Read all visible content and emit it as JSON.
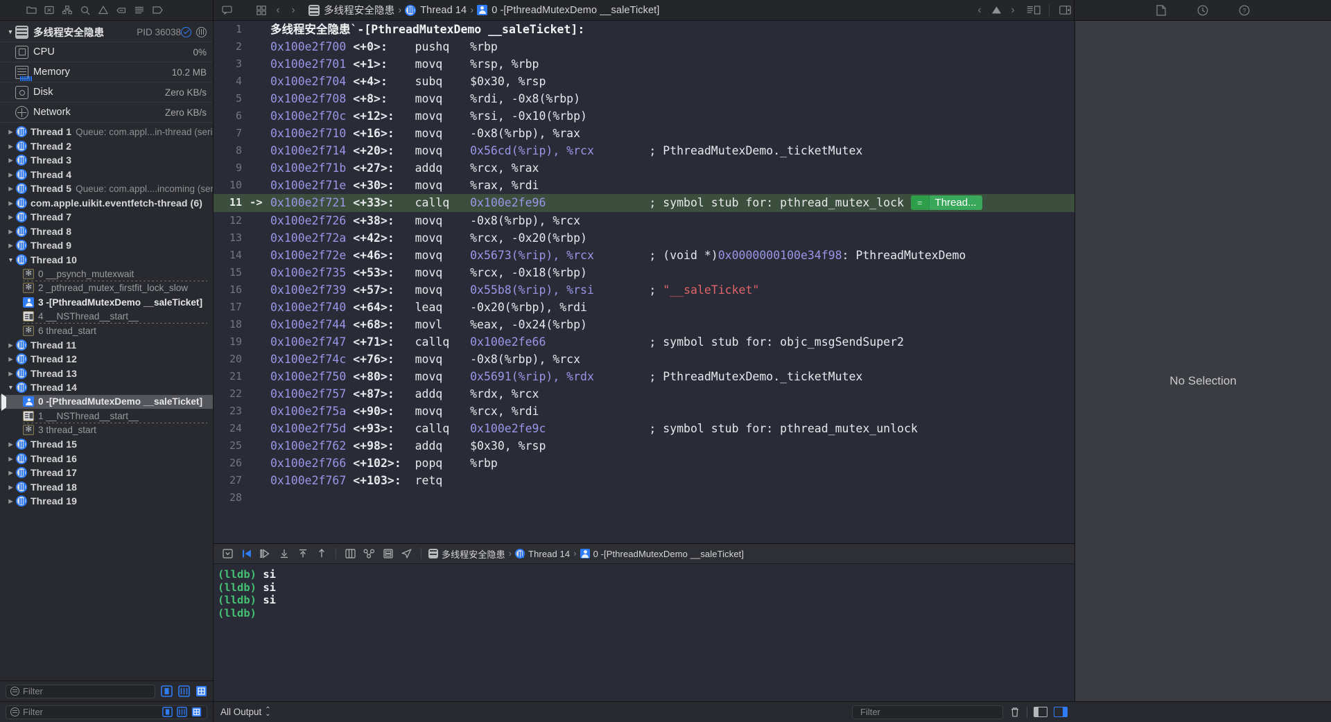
{
  "toolbar": {
    "left_icons": [
      "comment-icon"
    ],
    "mid_icons": [
      "navigator-toggle-icon",
      "back-chevron-icon",
      "forward-chevron-icon"
    ],
    "right_icons": [
      "document-icon",
      "history-clock-icon",
      "help-question-icon"
    ],
    "jump_icons": [
      "back-chevron-icon",
      "warning-triangle-icon",
      "forward-chevron-icon",
      "assistant-editor-icon",
      "inspector-toggle-icon"
    ],
    "breadcrumb": [
      {
        "icon": "project-icon",
        "label": "多线程安全隐患"
      },
      {
        "icon": "thread-icon",
        "label": "Thread 14"
      },
      {
        "icon": "stack-frame-icon",
        "label": "0 -[PthreadMutexDemo __saleTicket]"
      }
    ]
  },
  "navigator": {
    "icon_row": [
      "folder-icon",
      "source-control-icon",
      "hierarchy-icon",
      "search-icon",
      "warning-icon",
      "breakpoint-icon",
      "report-icon",
      "tag-icon"
    ],
    "process": {
      "name": "多线程安全隐患",
      "pid": "PID 36038",
      "status_icons": [
        "circle-check-icon",
        "thread-gauge-icon"
      ]
    },
    "gauges": [
      {
        "icon": "cpu-icon",
        "name": "CPU",
        "value": "0%"
      },
      {
        "icon": "memory-icon",
        "name": "Memory",
        "value": "10.2 MB"
      },
      {
        "icon": "disk-icon",
        "name": "Disk",
        "value": "Zero KB/s"
      },
      {
        "icon": "network-icon",
        "name": "Network",
        "value": "Zero KB/s"
      }
    ],
    "threads": [
      {
        "kind": "thread",
        "state": "collapsed",
        "label": "Thread 1",
        "queue": "Queue: com.appl...in-thread (serial)"
      },
      {
        "kind": "thread",
        "state": "collapsed",
        "label": "Thread 2",
        "queue": ""
      },
      {
        "kind": "thread",
        "state": "collapsed",
        "label": "Thread 3",
        "queue": ""
      },
      {
        "kind": "thread",
        "state": "collapsed",
        "label": "Thread 4",
        "queue": ""
      },
      {
        "kind": "thread",
        "state": "collapsed",
        "label": "Thread 5",
        "queue": "Queue: com.appl....incoming (serial)"
      },
      {
        "kind": "thread",
        "state": "collapsed",
        "label": "com.apple.uikit.eventfetch-thread (6)",
        "queue": ""
      },
      {
        "kind": "thread",
        "state": "collapsed",
        "label": "Thread 7",
        "queue": ""
      },
      {
        "kind": "thread",
        "state": "collapsed",
        "label": "Thread 8",
        "queue": ""
      },
      {
        "kind": "thread",
        "state": "collapsed",
        "label": "Thread 9",
        "queue": ""
      },
      {
        "kind": "thread",
        "state": "expanded",
        "label": "Thread 10",
        "queue": ""
      },
      {
        "kind": "frame",
        "icon": "system-frame-icon",
        "label": "0 __psynch_mutexwait",
        "user": false,
        "selected": false,
        "divider": true
      },
      {
        "kind": "frame",
        "icon": "system-frame-icon",
        "label": "2 _pthread_mutex_firstfit_lock_slow",
        "user": false,
        "selected": false,
        "divider": false
      },
      {
        "kind": "frame",
        "icon": "user-frame-icon",
        "label": "3 -[PthreadMutexDemo __saleTicket]",
        "user": true,
        "selected": false,
        "divider": false
      },
      {
        "kind": "frame",
        "icon": "nsthread-frame-icon",
        "label": "4 __NSThread__start__",
        "user": false,
        "selected": false,
        "divider": true
      },
      {
        "kind": "frame",
        "icon": "system-frame-icon",
        "label": "6 thread_start",
        "user": false,
        "selected": false,
        "divider": false
      },
      {
        "kind": "thread",
        "state": "collapsed",
        "label": "Thread 11",
        "queue": ""
      },
      {
        "kind": "thread",
        "state": "collapsed",
        "label": "Thread 12",
        "queue": ""
      },
      {
        "kind": "thread",
        "state": "collapsed",
        "label": "Thread 13",
        "queue": ""
      },
      {
        "kind": "thread",
        "state": "expanded",
        "label": "Thread 14",
        "queue": ""
      },
      {
        "kind": "frame",
        "icon": "user-frame-icon",
        "label": "0 -[PthreadMutexDemo __saleTicket]",
        "user": true,
        "selected": true,
        "divider": false
      },
      {
        "kind": "frame",
        "icon": "nsthread-frame-icon",
        "label": "1 __NSThread__start__",
        "user": false,
        "selected": false,
        "divider": true
      },
      {
        "kind": "frame",
        "icon": "system-frame-icon",
        "label": "3 thread_start",
        "user": false,
        "selected": false,
        "divider": false
      },
      {
        "kind": "thread",
        "state": "collapsed",
        "label": "Thread 15",
        "queue": ""
      },
      {
        "kind": "thread",
        "state": "collapsed",
        "label": "Thread 16",
        "queue": ""
      },
      {
        "kind": "thread",
        "state": "collapsed",
        "label": "Thread 17",
        "queue": ""
      },
      {
        "kind": "thread",
        "state": "collapsed",
        "label": "Thread 18",
        "queue": ""
      },
      {
        "kind": "thread",
        "state": "collapsed",
        "label": "Thread 19",
        "queue": ""
      }
    ],
    "filter": {
      "placeholder": "Filter",
      "value": "",
      "buttons": [
        "show-only-crashed-icon",
        "show-only-queues-icon",
        "show-only-user-frames-icon"
      ]
    }
  },
  "editor": {
    "highlight_line": 11,
    "badge": {
      "equals": "=",
      "thread": "Thread..."
    },
    "lines": [
      {
        "n": 1,
        "pc": "",
        "type": "title",
        "text": "多线程安全隐患`-[PthreadMutexDemo __saleTicket]:"
      },
      {
        "n": 2,
        "pc": "",
        "addr": "0x100e2f700",
        "off": "<+0>:",
        "mnem": "pushq",
        "oper": "%rbp",
        "comment": ""
      },
      {
        "n": 3,
        "pc": "",
        "addr": "0x100e2f701",
        "off": "<+1>:",
        "mnem": "movq",
        "oper": "%rsp, %rbp",
        "comment": ""
      },
      {
        "n": 4,
        "pc": "",
        "addr": "0x100e2f704",
        "off": "<+4>:",
        "mnem": "subq",
        "oper": "$0x30, %rsp",
        "comment": ""
      },
      {
        "n": 5,
        "pc": "",
        "addr": "0x100e2f708",
        "off": "<+8>:",
        "mnem": "movq",
        "oper": "%rdi, -0x8(%rbp)",
        "comment": ""
      },
      {
        "n": 6,
        "pc": "",
        "addr": "0x100e2f70c",
        "off": "<+12>:",
        "mnem": "movq",
        "oper": "%rsi, -0x10(%rbp)",
        "comment": ""
      },
      {
        "n": 7,
        "pc": "",
        "addr": "0x100e2f710",
        "off": "<+16>:",
        "mnem": "movq",
        "oper": "-0x8(%rbp), %rax",
        "comment": ""
      },
      {
        "n": 8,
        "pc": "",
        "addr": "0x100e2f714",
        "off": "<+20>:",
        "mnem": "movq",
        "oper": "0x56cd(%rip), %rcx",
        "comment": "; PthreadMutexDemo._ticketMutex"
      },
      {
        "n": 9,
        "pc": "",
        "addr": "0x100e2f71b",
        "off": "<+27>:",
        "mnem": "addq",
        "oper": "%rcx, %rax",
        "comment": ""
      },
      {
        "n": 10,
        "pc": "",
        "addr": "0x100e2f71e",
        "off": "<+30>:",
        "mnem": "movq",
        "oper": "%rax, %rdi",
        "comment": ""
      },
      {
        "n": 11,
        "pc": "->",
        "addr": "0x100e2f721",
        "off": "<+33>:",
        "mnem": "callq",
        "oper": "0x100e2fe96",
        "comment": "; symbol stub for: pthread_mutex_lock"
      },
      {
        "n": 12,
        "pc": "",
        "addr": "0x100e2f726",
        "off": "<+38>:",
        "mnem": "movq",
        "oper": "-0x8(%rbp), %rcx",
        "comment": ""
      },
      {
        "n": 13,
        "pc": "",
        "addr": "0x100e2f72a",
        "off": "<+42>:",
        "mnem": "movq",
        "oper": "%rcx, -0x20(%rbp)",
        "comment": ""
      },
      {
        "n": 14,
        "pc": "",
        "addr": "0x100e2f72e",
        "off": "<+46>:",
        "mnem": "movq",
        "oper": "0x5673(%rip), %rcx",
        "comment": "; (void *)0x0000000100e34f98: PthreadMutexDemo"
      },
      {
        "n": 15,
        "pc": "",
        "addr": "0x100e2f735",
        "off": "<+53>:",
        "mnem": "movq",
        "oper": "%rcx, -0x18(%rbp)",
        "comment": ""
      },
      {
        "n": 16,
        "pc": "",
        "addr": "0x100e2f739",
        "off": "<+57>:",
        "mnem": "movq",
        "oper": "0x55b8(%rip), %rsi",
        "comment": "; \"__saleTicket\""
      },
      {
        "n": 17,
        "pc": "",
        "addr": "0x100e2f740",
        "off": "<+64>:",
        "mnem": "leaq",
        "oper": "-0x20(%rbp), %rdi",
        "comment": ""
      },
      {
        "n": 18,
        "pc": "",
        "addr": "0x100e2f744",
        "off": "<+68>:",
        "mnem": "movl",
        "oper": "%eax, -0x24(%rbp)",
        "comment": ""
      },
      {
        "n": 19,
        "pc": "",
        "addr": "0x100e2f747",
        "off": "<+71>:",
        "mnem": "callq",
        "oper": "0x100e2fe66",
        "comment": "; symbol stub for: objc_msgSendSuper2"
      },
      {
        "n": 20,
        "pc": "",
        "addr": "0x100e2f74c",
        "off": "<+76>:",
        "mnem": "movq",
        "oper": "-0x8(%rbp), %rcx",
        "comment": ""
      },
      {
        "n": 21,
        "pc": "",
        "addr": "0x100e2f750",
        "off": "<+80>:",
        "mnem": "movq",
        "oper": "0x5691(%rip), %rdx",
        "comment": "; PthreadMutexDemo._ticketMutex"
      },
      {
        "n": 22,
        "pc": "",
        "addr": "0x100e2f757",
        "off": "<+87>:",
        "mnem": "addq",
        "oper": "%rdx, %rcx",
        "comment": ""
      },
      {
        "n": 23,
        "pc": "",
        "addr": "0x100e2f75a",
        "off": "<+90>:",
        "mnem": "movq",
        "oper": "%rcx, %rdi",
        "comment": ""
      },
      {
        "n": 24,
        "pc": "",
        "addr": "0x100e2f75d",
        "off": "<+93>:",
        "mnem": "callq",
        "oper": "0x100e2fe9c",
        "comment": "; symbol stub for: pthread_mutex_unlock"
      },
      {
        "n": 25,
        "pc": "",
        "addr": "0x100e2f762",
        "off": "<+98>:",
        "mnem": "addq",
        "oper": "$0x30, %rsp",
        "comment": ""
      },
      {
        "n": 26,
        "pc": "",
        "addr": "0x100e2f766",
        "off": "<+102>:",
        "mnem": "popq",
        "oper": "%rbp",
        "comment": ""
      },
      {
        "n": 27,
        "pc": "",
        "addr": "0x100e2f767",
        "off": "<+103>:",
        "mnem": "retq",
        "oper": "",
        "comment": ""
      },
      {
        "n": 28,
        "pc": "",
        "type": "blank",
        "text": ""
      }
    ]
  },
  "debug_bar": {
    "icons": [
      "hide-debug-area-icon",
      "continue-icon",
      "step-over-icon",
      "step-into-icon",
      "step-out-icon",
      "step-out-quickly-icon",
      "view-hierarchy-icon",
      "memory-graph-icon",
      "environment-overrides-icon",
      "simulate-location-icon"
    ],
    "breadcrumb": [
      {
        "icon": "project-icon",
        "label": "多线程安全隐患"
      },
      {
        "icon": "thread-icon",
        "label": "Thread 14"
      },
      {
        "icon": "stack-frame-icon",
        "label": "0 -[PthreadMutexDemo __saleTicket]"
      }
    ]
  },
  "console": {
    "lines": [
      {
        "prompt": "(lldb)",
        "cmd": "si"
      },
      {
        "prompt": "(lldb)",
        "cmd": "si"
      },
      {
        "prompt": "(lldb)",
        "cmd": "si"
      },
      {
        "prompt": "(lldb)",
        "cmd": ""
      }
    ]
  },
  "inspector": {
    "empty_text": "No Selection"
  },
  "status_bar": {
    "output_scope": "All Output",
    "console_filter": {
      "placeholder": "Filter",
      "value": ""
    },
    "tools": [
      "clear-console-icon",
      "show-variables-view-icon",
      "show-console-view-icon"
    ]
  },
  "colors": {
    "accent": "#2f7cf6",
    "editor_bg": "#292b36",
    "highlight": "#3c4e3e",
    "badge_green": "#3aa85b",
    "address": "#9b96e8",
    "string": "#e0646b",
    "prompt_green": "#45c173"
  }
}
